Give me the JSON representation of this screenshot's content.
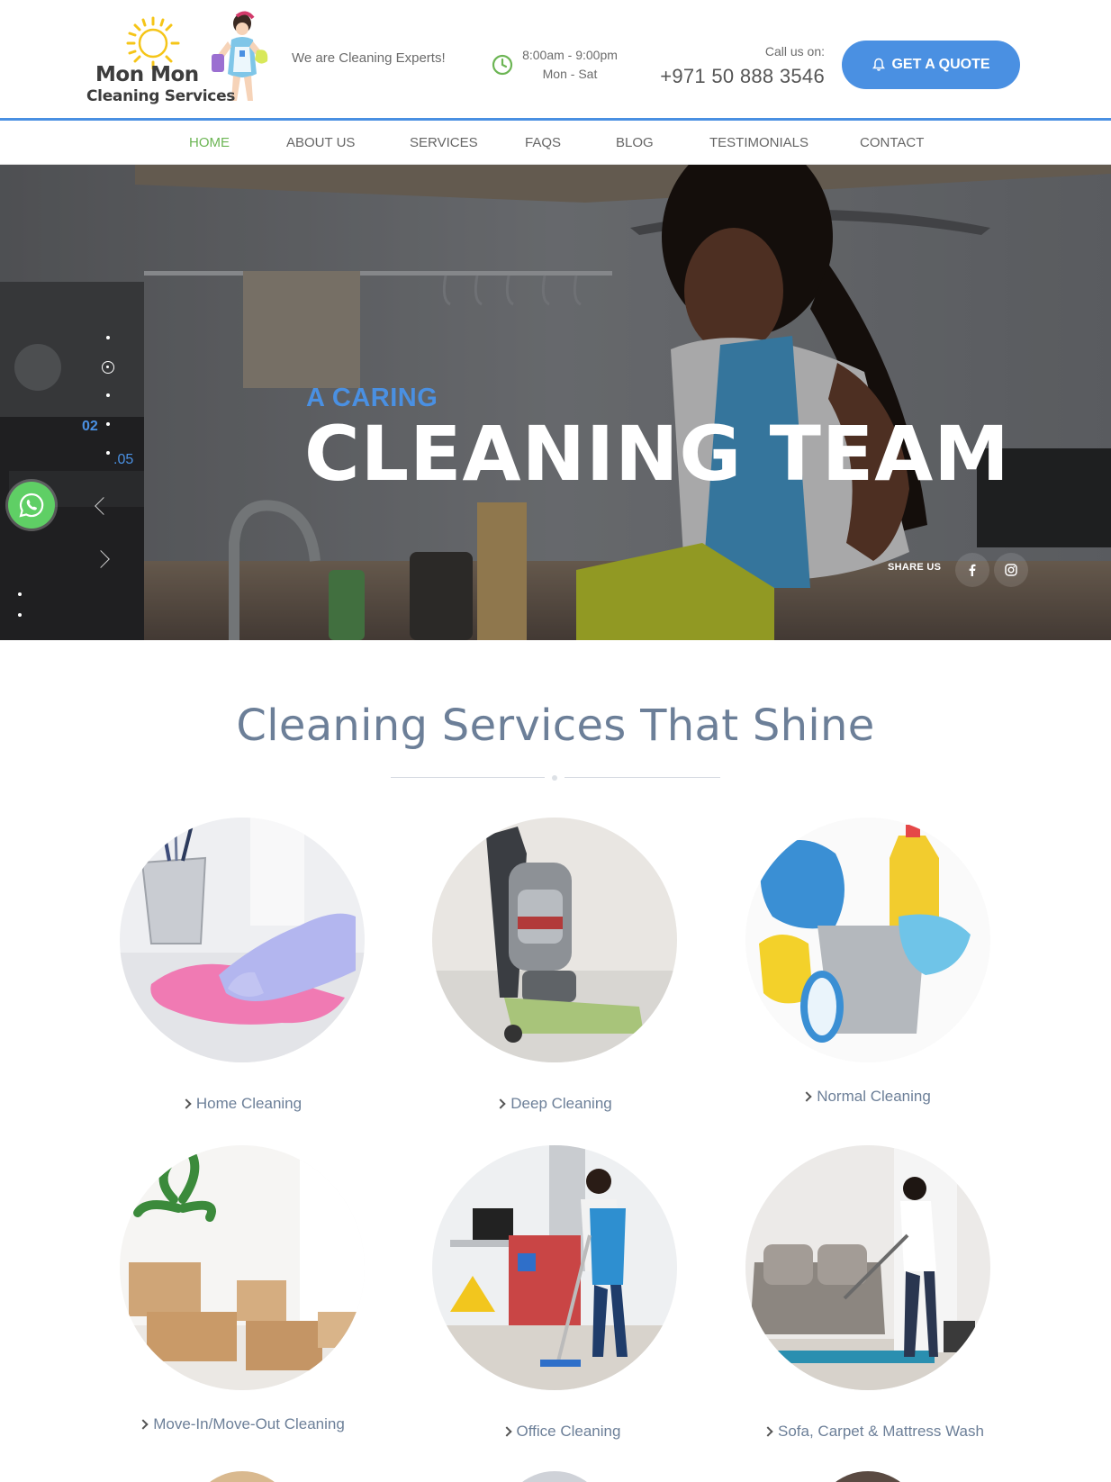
{
  "header": {
    "logo_line1": "Mon Mon",
    "logo_line2": "Cleaning Services",
    "tagline": "We are Cleaning Experts!",
    "hours_line1": "8:00am - 9:00pm",
    "hours_line2": "Mon - Sat",
    "call_label": "Call us on:",
    "phone": "+971 50 888 3546",
    "quote_button": "GET A QUOTE",
    "icons": {
      "clock": "clock-icon",
      "bell": "bell-icon",
      "logo": "sun-and-cleaning-lady-logo"
    }
  },
  "nav": {
    "items": [
      "HOME",
      "ABOUT US",
      "SERVICES",
      "FAQS",
      "BLOG",
      "TESTIMONIALS",
      "CONTACT"
    ],
    "active": "HOME"
  },
  "hero": {
    "kicker": "A CARING",
    "title": "CLEANING TEAM",
    "slide_current": "02",
    "slide_total": ".05",
    "share_label": "SHARE US",
    "social": [
      "facebook-icon",
      "instagram-icon"
    ],
    "whatsapp": "whatsapp-icon"
  },
  "services": {
    "title": "Cleaning Services That Shine",
    "items": [
      "Home Cleaning",
      "Deep Cleaning",
      "Normal Cleaning",
      "Move-In/Move-Out Cleaning",
      "Office Cleaning",
      "Sofa, Carpet & Mattress Wash"
    ]
  },
  "colors": {
    "accent_blue": "#4a90e2",
    "active_green": "#6cb554",
    "heading_slate": "#6c7f98",
    "whatsapp_green": "#5fcf65"
  }
}
